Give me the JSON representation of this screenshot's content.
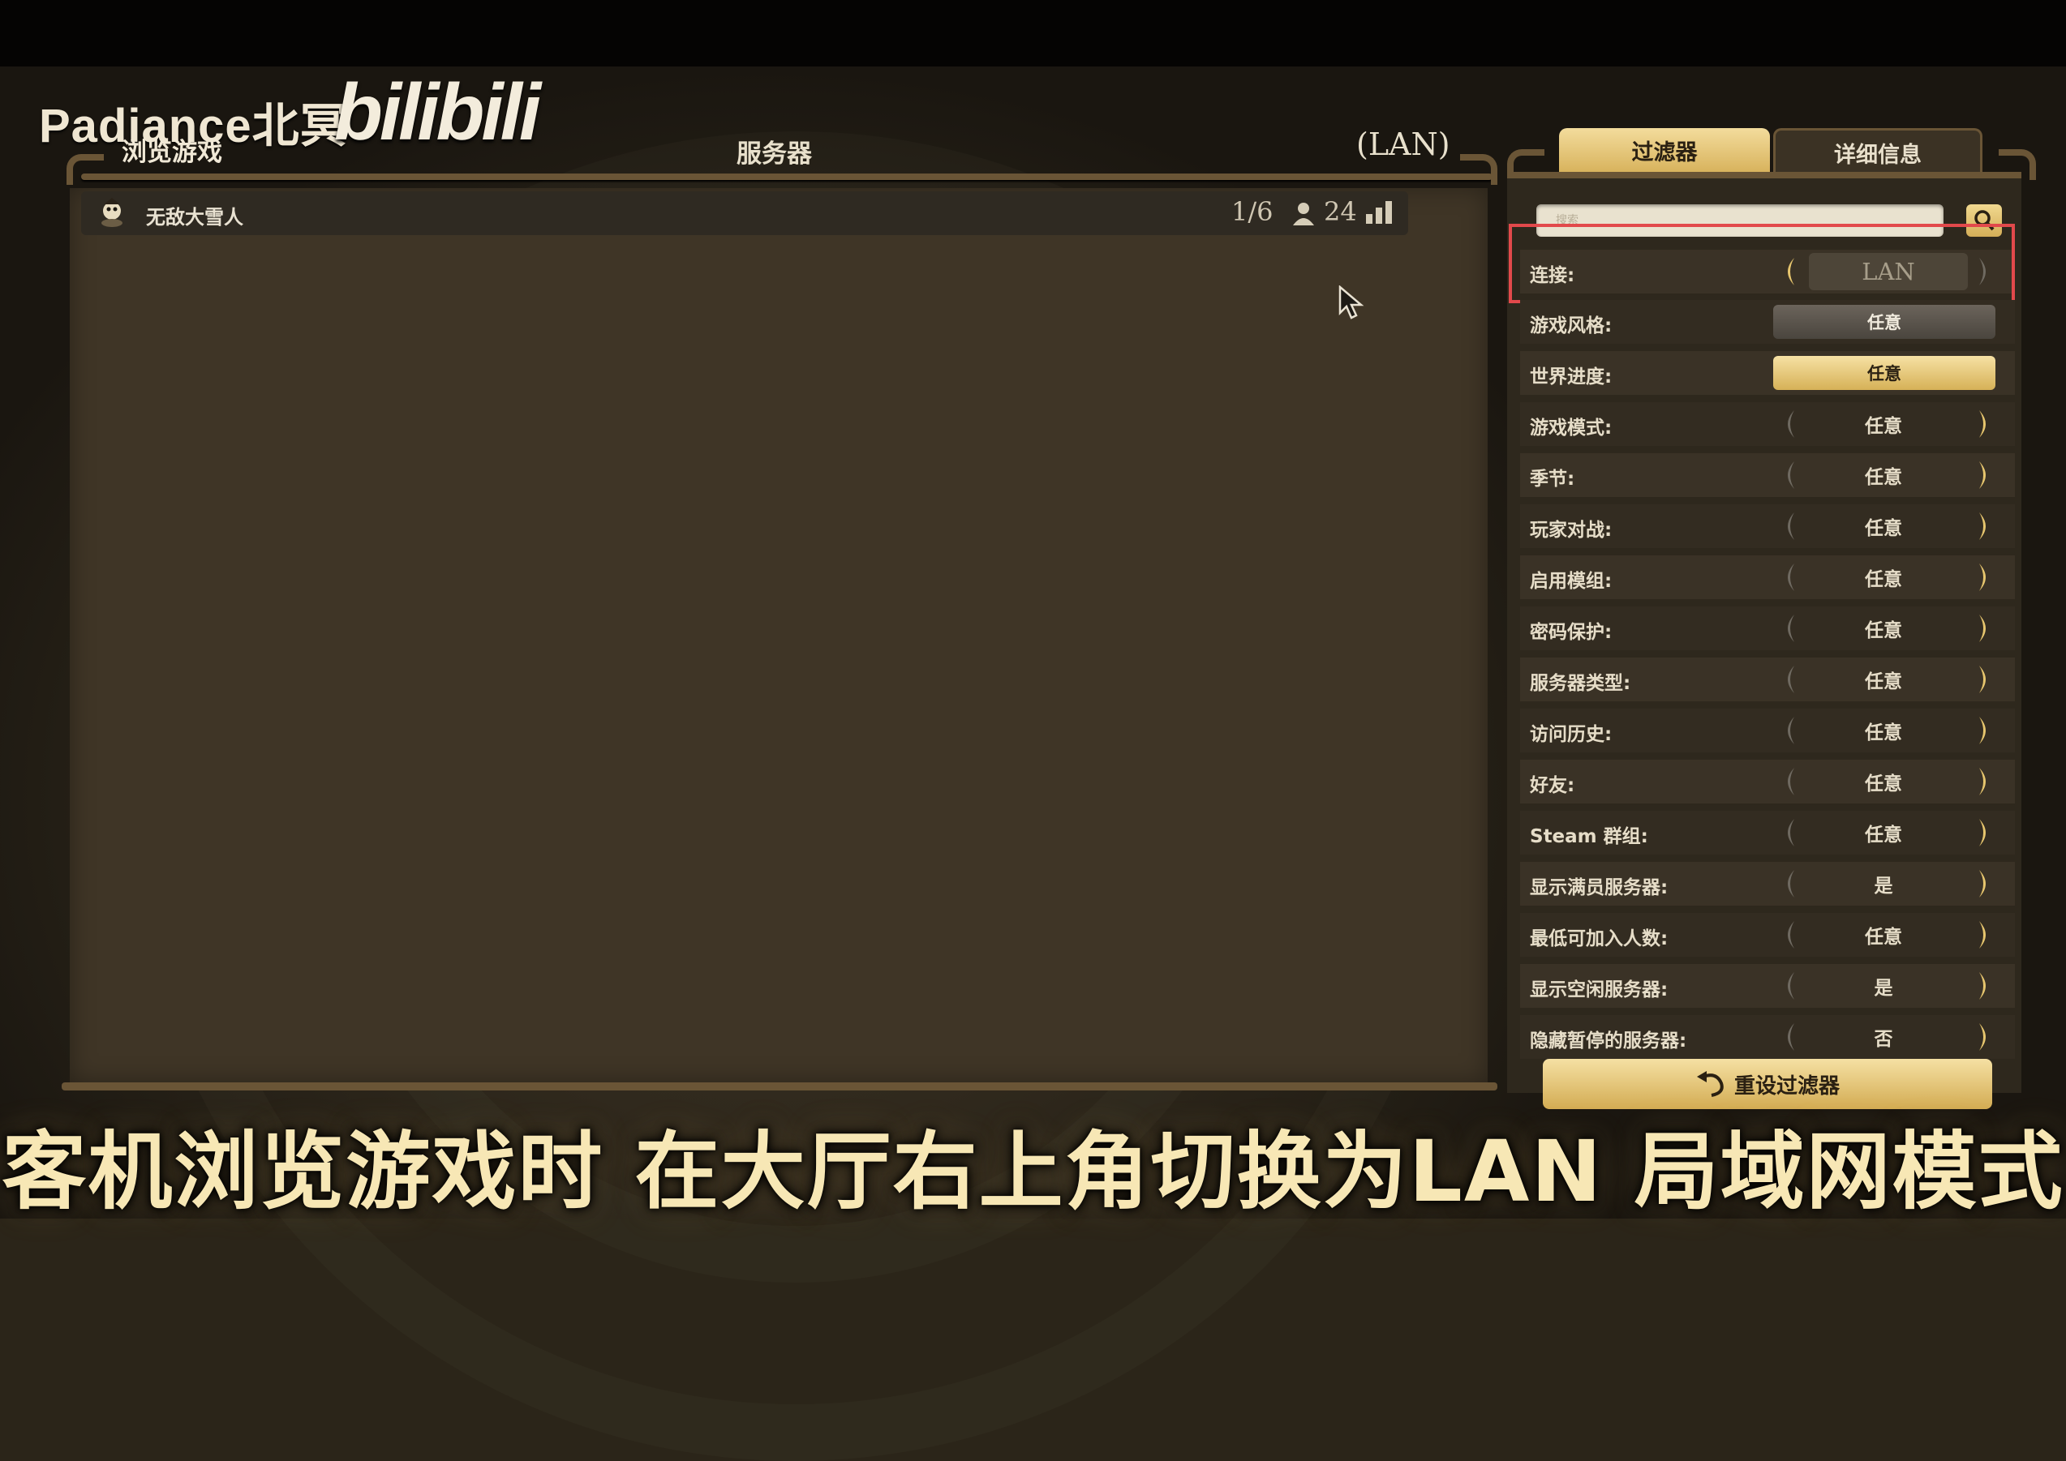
{
  "watermark": {
    "channel": "Padiance北冥",
    "platform": "bilibili"
  },
  "header": {
    "browse_title": "浏览游戏",
    "servers_title": "服务器",
    "lan_title": "(LAN)"
  },
  "server_list": [
    {
      "name": "无敌大雪人",
      "players": "1/6",
      "day": "24"
    }
  ],
  "tabs": {
    "filters": "过滤器",
    "details": "详细信息"
  },
  "search": {
    "placeholder": "搜索"
  },
  "filters": [
    {
      "label": "连接:",
      "value": "LAN"
    },
    {
      "label": "游戏风格:",
      "value": "任意"
    },
    {
      "label": "世界进度:",
      "value": "任意"
    },
    {
      "label": "游戏模式:",
      "value": "任意"
    },
    {
      "label": "季节:",
      "value": "任意"
    },
    {
      "label": "玩家对战:",
      "value": "任意"
    },
    {
      "label": "启用模组:",
      "value": "任意"
    },
    {
      "label": "密码保护:",
      "value": "任意"
    },
    {
      "label": "服务器类型:",
      "value": "任意"
    },
    {
      "label": "访问历史:",
      "value": "任意"
    },
    {
      "label": "好友:",
      "value": "任意"
    },
    {
      "label": "Steam 群组:",
      "value": "任意"
    },
    {
      "label": "显示满员服务器:",
      "value": "是"
    },
    {
      "label": "最低可加入人数:",
      "value": "任意"
    },
    {
      "label": "显示空闲服务器:",
      "value": "是"
    },
    {
      "label": "隐藏暂停的服务器:",
      "value": "否"
    }
  ],
  "reset_button": "重设过滤器",
  "caption": "客机浏览游戏时 在大厅右上角切换为LAN 局域网模式",
  "colors": {
    "accent_gold": "#d8b35d",
    "highlight_red": "#e2494b",
    "frame_brown": "#6a5536"
  }
}
